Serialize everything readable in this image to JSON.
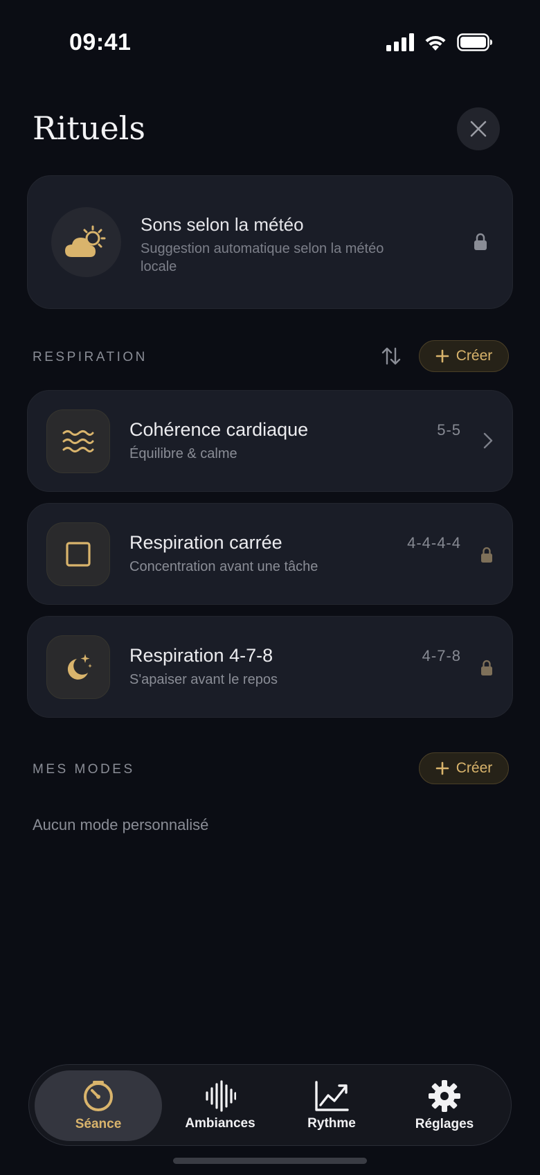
{
  "status_bar": {
    "time": "09:41"
  },
  "header": {
    "title": "Rituels"
  },
  "weather_card": {
    "title": "Sons selon la météo",
    "description": "Suggestion automatique selon la météo locale"
  },
  "respiration": {
    "label": "RESPIRATION",
    "create_label": "Créer",
    "items": [
      {
        "name": "Cohérence cardiaque",
        "subtitle": "Équilibre & calme",
        "pattern": "5-5",
        "icon": "waves-icon",
        "locked": false
      },
      {
        "name": "Respiration carrée",
        "subtitle": "Concentration avant une tâche",
        "pattern": "4-4-4-4",
        "icon": "square-icon",
        "locked": true
      },
      {
        "name": "Respiration 4-7-8",
        "subtitle": "S'apaiser avant le repos",
        "pattern": "4-7-8",
        "icon": "moon-stars-icon",
        "locked": true
      }
    ]
  },
  "mes_modes": {
    "label": "MES MODES",
    "create_label": "Créer",
    "empty_text": "Aucun mode personnalisé"
  },
  "tab_bar": {
    "tabs": [
      {
        "label": "Séance",
        "icon": "timer-icon",
        "active": true
      },
      {
        "label": "Ambiances",
        "icon": "waveform-icon",
        "active": false
      },
      {
        "label": "Rythme",
        "icon": "chart-icon",
        "active": false
      },
      {
        "label": "Réglages",
        "icon": "gear-icon",
        "active": false
      }
    ]
  },
  "colors": {
    "accent": "#d9b46c",
    "background": "#0b0d14",
    "card": "#1a1d27"
  }
}
